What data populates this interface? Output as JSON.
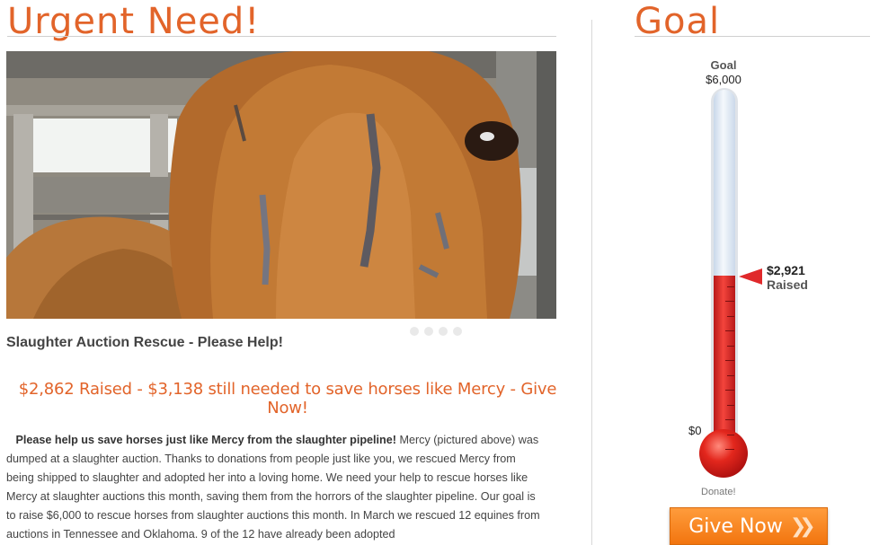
{
  "urgent": {
    "heading": "Urgent Need!",
    "subtitle": "Slaughter Auction Rescue - Please Help!",
    "raised_line": "$2,862 Raised - $3,138 still needed to save horses like Mercy - Give Now!",
    "body_bold": "Please help us save horses just like Mercy from the slaughter pipeline!",
    "body_rest": " Mercy (pictured above) was dumped at a slaughter auction.  Thanks to donations from people just like you, we rescued Mercy from being shipped to slaughter and adopted her into a loving home. We need your help to rescue horses like Mercy at slaughter auctions this month, saving them from the horrors of the slaughter pipeline. Our goal is to raise $6,000 to rescue horses from slaughter auctions this month. In March we rescued 12 equines from auctions in Tennessee and Oklahoma. 9 of the 12 have already been adopted",
    "slide_count": 4
  },
  "goal": {
    "heading": "Goal",
    "label": "Goal",
    "amount": "$6,000",
    "raised_amount": "$2,921",
    "raised_label": "Raised",
    "zero_label": "$0",
    "progress_fraction": 0.487,
    "donate_label": "Donate!",
    "give_button": "Give Now",
    "give_icon": "double-chevron-right-icon",
    "mercury_color": "#e3271d",
    "accent_color": "#e2642a"
  }
}
